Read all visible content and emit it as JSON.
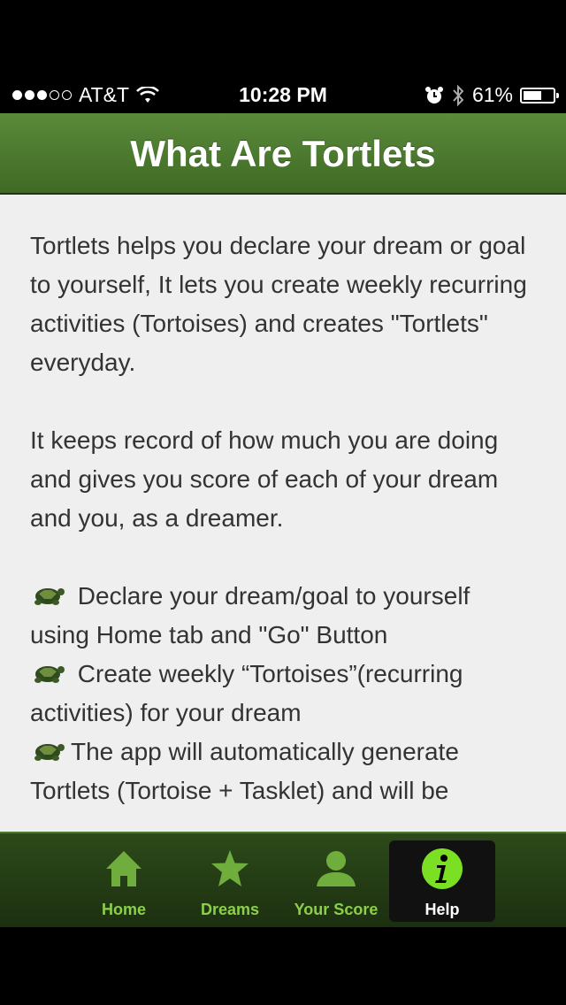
{
  "status_bar": {
    "carrier": "AT&T",
    "time": "10:28 PM",
    "battery": "61%",
    "battery_level": 0.61,
    "signal_bars_filled": 3,
    "signal_bars_total": 5
  },
  "nav": {
    "title": "What Are Tortlets"
  },
  "content": {
    "paragraph1": "Tortlets helps you declare your dream or goal to yourself, It lets you create weekly recurring activities (Tortoises) and creates \"Tortlets\" everyday.",
    "paragraph2": "It keeps record of how much you are doing and gives you score of each of your dream and you, as a dreamer.",
    "bullets": [
      {
        "icon": "turtle-icon",
        "text": " Declare your dream/goal to yourself using Home tab and \"Go\" Button"
      },
      {
        "icon": "turtle-icon",
        "text": " Create weekly “Tortoises”(recurring activities) for your dream"
      },
      {
        "icon": "turtle-icon",
        "text": "The app will automatically generate Tortlets (Tortoise + Tasklet) and will be"
      }
    ]
  },
  "tab_bar": {
    "tabs": [
      {
        "label": "Home",
        "icon": "home-icon"
      },
      {
        "label": "Dreams",
        "icon": "star-icon"
      },
      {
        "label": "Your Score",
        "icon": "person-icon"
      },
      {
        "label": "Help",
        "icon": "info-icon",
        "selected": true
      }
    ]
  },
  "colors": {
    "nav_green": "#4a7a2c",
    "tab_label_green": "#8ccf4a",
    "info_icon_green": "#7be023"
  }
}
